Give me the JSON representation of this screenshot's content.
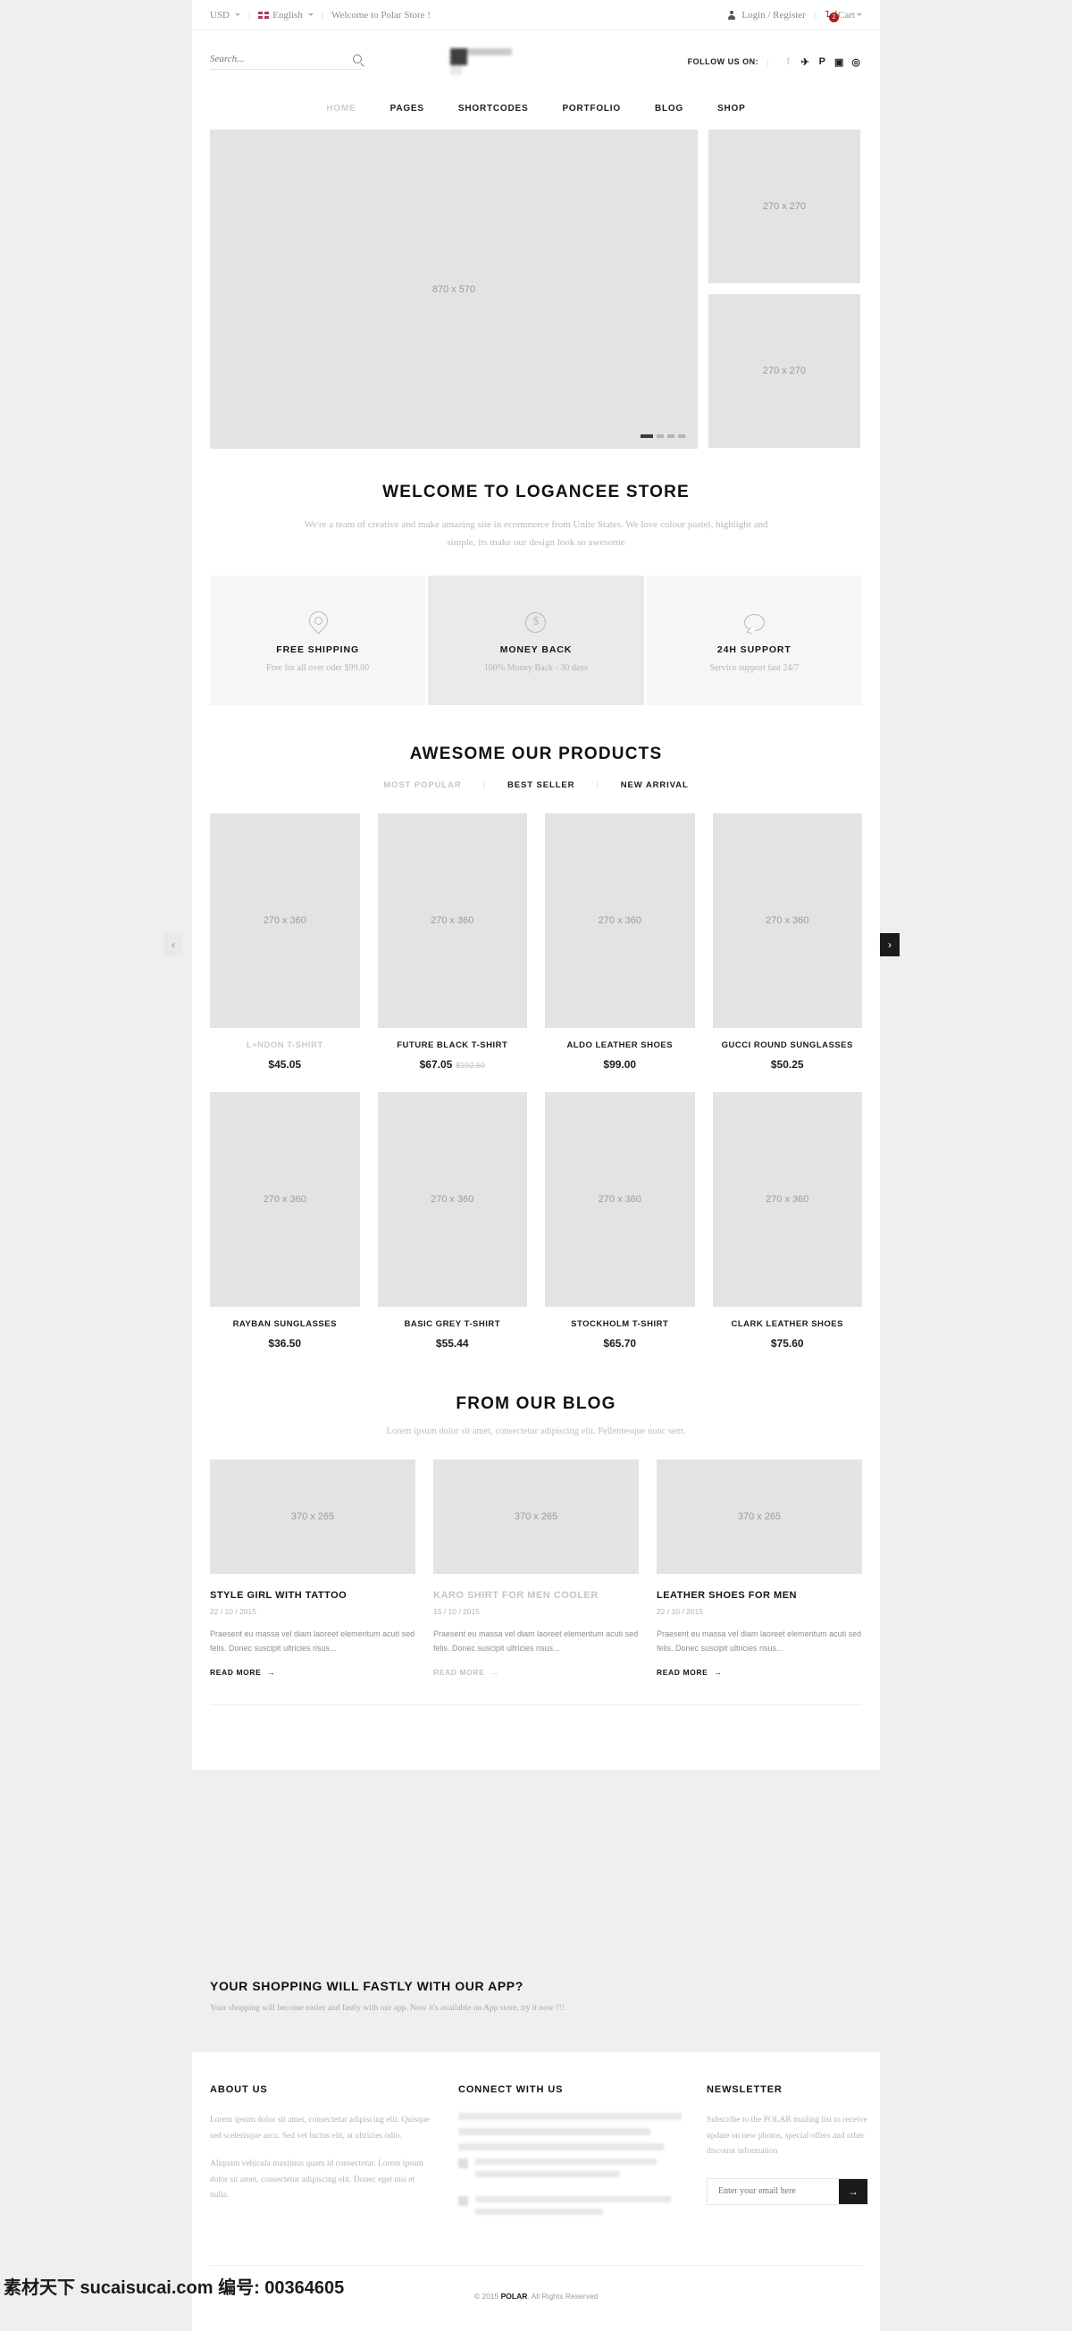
{
  "topbar": {
    "currency": "USD",
    "language": "English",
    "welcome": "Welcome to Polar Store !",
    "account": "Login / Register",
    "cart_label": "Cart",
    "cart_count": "2",
    "separator": "|"
  },
  "header": {
    "search_placeholder": "Search...",
    "search_value": "",
    "follow_label": "FOLLOW US ON:",
    "social": [
      {
        "name": "facebook-icon",
        "glyph": "f"
      },
      {
        "name": "twitter-icon",
        "glyph": "✈"
      },
      {
        "name": "pinterest-icon",
        "glyph": "P"
      },
      {
        "name": "instagram-icon",
        "glyph": "▣"
      },
      {
        "name": "dribbble-icon",
        "glyph": "◎"
      }
    ]
  },
  "nav": [
    {
      "label": "HOME",
      "active": true
    },
    {
      "label": "PAGES",
      "active": false
    },
    {
      "label": "SHORTCODES",
      "active": false
    },
    {
      "label": "PORTFOLIO",
      "active": false
    },
    {
      "label": "BLOG",
      "active": false
    },
    {
      "label": "SHOP",
      "active": false
    }
  ],
  "slider": {
    "main_placeholder": "870 x 570",
    "side_1": "270 x 270",
    "side_2": "270 x 270"
  },
  "welcome": {
    "title": "WELCOME TO LOGANCEE STORE",
    "text": "We're a team of creative and make amazing site in ecommerce from Unite States. We love colour pastel, highlight and simple, its make our design look so awesome"
  },
  "features": [
    {
      "icon": "location-pin-icon",
      "title": "FREE SHIPPING",
      "desc": "Free for all over oder $99.00"
    },
    {
      "icon": "dollar-coin-icon",
      "title": "MONEY BACK",
      "desc": "100% Money Back - 30 days"
    },
    {
      "icon": "chat-bubble-icon",
      "title": "24H SUPPORT",
      "desc": "Service support fast 24/7"
    }
  ],
  "products": {
    "title": "AWESOME OUR PRODUCTS",
    "tabs": [
      {
        "label": "MOST POPULAR",
        "active": false
      },
      {
        "label": "BEST SELLER",
        "active": true
      },
      {
        "label": "NEW ARRIVAL",
        "active": true
      }
    ],
    "tab_separator": "|",
    "image_placeholder": "270 x 360",
    "prev_arrow": "‹",
    "next_arrow": "›",
    "row1": [
      {
        "name": "L+NDON T-SHIRT",
        "price": "$45.05",
        "old_price": "",
        "dim": true
      },
      {
        "name": "FUTURE BLACK T-SHIRT",
        "price": "$67.05",
        "old_price": "$102.50",
        "dim": false
      },
      {
        "name": "ALDO LEATHER SHOES",
        "price": "$99.00",
        "old_price": "",
        "dim": false
      },
      {
        "name": "GUCCI ROUND SUNGLASSES",
        "price": "$50.25",
        "old_price": "",
        "dim": false
      }
    ],
    "row2": [
      {
        "name": "RAYBAN SUNGLASSES",
        "price": "$36.50",
        "old_price": "",
        "dim": false
      },
      {
        "name": "BASIC GREY T-SHIRT",
        "price": "$55.44",
        "old_price": "",
        "dim": false
      },
      {
        "name": "STOCKHOLM T-SHIRT",
        "price": "$65.70",
        "old_price": "",
        "dim": false
      },
      {
        "name": "CLARK LEATHER SHOES",
        "price": "$75.60",
        "old_price": "",
        "dim": false
      }
    ]
  },
  "blog": {
    "title": "FROM OUR BLOG",
    "subtitle": "Lorem ipsum dolor sit amet, consectetur adipiscing elit. Pellentesque nunc sem.",
    "image_placeholder": "370 x 265",
    "read_more": "READ MORE",
    "arrow": "→",
    "posts": [
      {
        "title": "STYLE GIRL WITH TATTOO",
        "date": "22 / 10 / 2015",
        "excerpt": "Praesent eu massa vel diam laoreet elementum acuti sed felis. Donec suscipit ultricies risus...",
        "dim": false
      },
      {
        "title": "KARO SHIRT FOR MEN COOLER",
        "date": "15 / 10 / 2015",
        "excerpt": "Praesent eu massa vel diam laoreet elementum acuti sed felis. Donec suscipit ultricies risus...",
        "dim": true
      },
      {
        "title": "LEATHER SHOES FOR MEN",
        "date": "22 / 10 / 2015",
        "excerpt": "Praesent eu massa vel diam laoreet elementum acuti sed felis. Donec suscipit ultricies risus...",
        "dim": false
      }
    ]
  },
  "appband": {
    "title": "YOUR SHOPPING WILL FASTLY WITH OUR APP?",
    "text": "Your shopping will become easier and fastly with our app. Now it's available on App store, try it now !!!"
  },
  "footer": {
    "about": {
      "title": "ABOUT US",
      "p1": "Lorem ipsum dolor sit amet, consectetur adipiscing elit. Quisque sed scelerisque arcu. Sed vel luctus elit, at ultricies odio.",
      "p2": "Aliquam vehicula maximus quam id consectetur. Lorem ipsum dolor sit amet, consectetur adipiscing elit. Donec eget nisi et nulla."
    },
    "connect": {
      "title": "CONNECT WITH US"
    },
    "newsletter": {
      "title": "NEWSLETTER",
      "text": "Subscribe to the POLAR mailing list  to receive update on new photos, special offers and other discount information",
      "placeholder": "Enter your email here",
      "value": "",
      "submit_arrow": "→"
    },
    "copyright_prefix": "© 2015 ",
    "copyright_brand": "POLAR",
    "copyright_suffix": ". All Rights Reserved"
  },
  "watermark": "素材天下 sucaisucai.com  编号: 00364605",
  "colors": {
    "accent_dark": "#1b1b1b",
    "cart_badge": "#b01b1b",
    "placeholder_bg": "#e3e3e3",
    "page_bg": "#efefef"
  }
}
